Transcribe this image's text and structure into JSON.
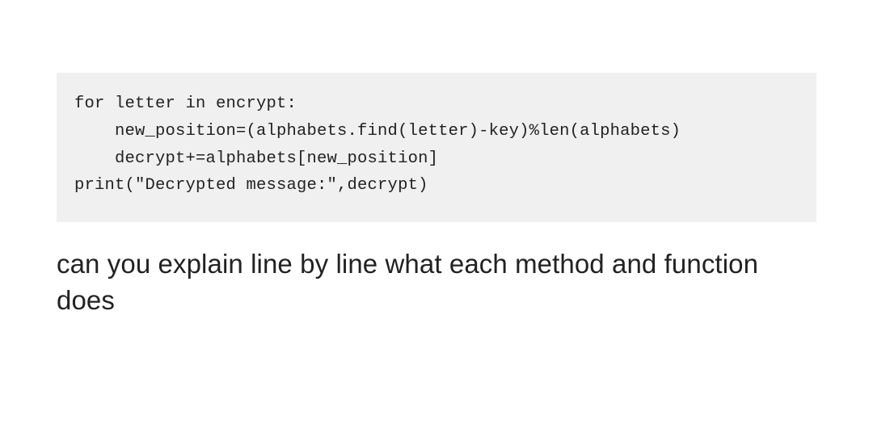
{
  "code": {
    "line1": "for letter in encrypt:",
    "line2": "    new_position=(alphabets.find(letter)-key)%len(alphabets)",
    "line3": "    decrypt+=alphabets[new_position]",
    "line4": "print(\"Decrypted message:\",decrypt)"
  },
  "question": "can you explain line by line what each method and function does"
}
